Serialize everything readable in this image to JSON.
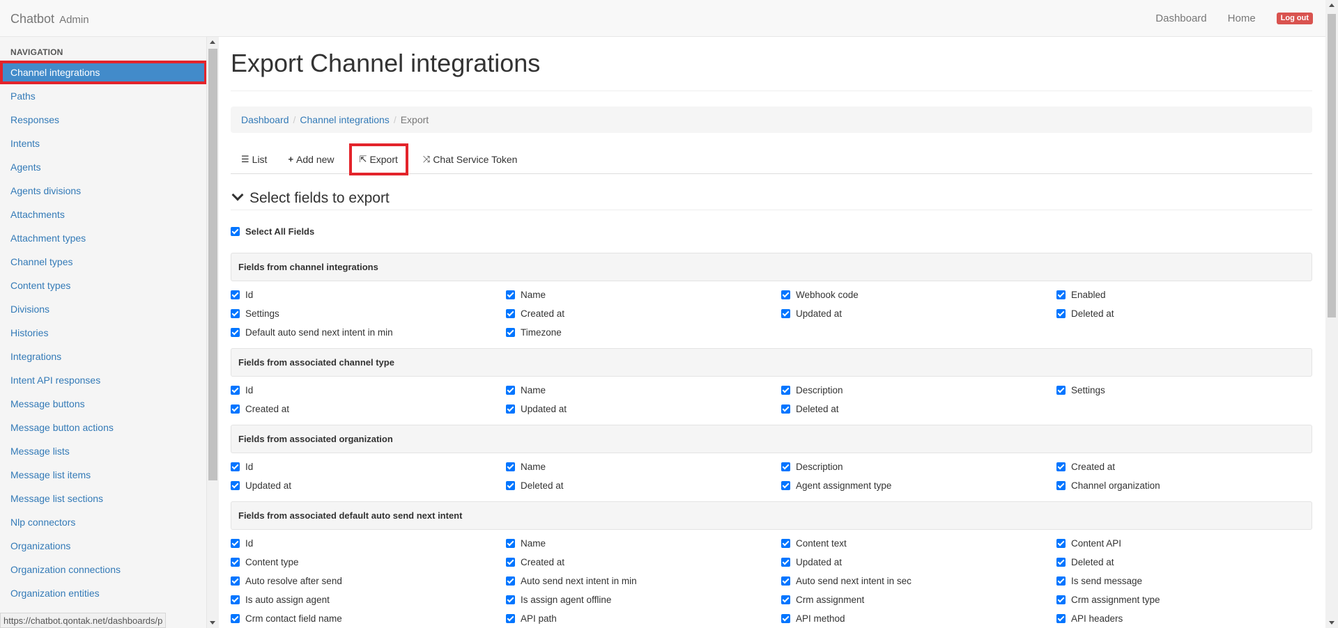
{
  "navbar": {
    "brand": "Chatbot",
    "brand_sub": "Admin",
    "links": [
      "Dashboard",
      "Home"
    ],
    "logout": "Log out"
  },
  "sidebar": {
    "heading": "NAVIGATION",
    "items": [
      "Channel integrations",
      "Paths",
      "Responses",
      "Intents",
      "Agents",
      "Agents divisions",
      "Attachments",
      "Attachment types",
      "Channel types",
      "Content types",
      "Divisions",
      "Histories",
      "Integrations",
      "Intent API responses",
      "Message buttons",
      "Message button actions",
      "Message lists",
      "Message list items",
      "Message list sections",
      "Nlp connectors",
      "Organizations",
      "Organization connections",
      "Organization entities"
    ],
    "active_index": 0
  },
  "status_bar": {
    "url": "https://chatbot.qontak.net/dashboards/p"
  },
  "page": {
    "title": "Export Channel integrations",
    "breadcrumb": {
      "items": [
        "Dashboard",
        "Channel integrations"
      ],
      "active": "Export"
    },
    "tabs": [
      {
        "icon": "☰",
        "icon_name": "list-icon",
        "label": "List"
      },
      {
        "icon": "+",
        "icon_name": "plus-icon",
        "label": "Add new"
      },
      {
        "icon": "⇱",
        "icon_name": "share-icon",
        "label": "Export"
      },
      {
        "icon": "⤨",
        "icon_name": "random-icon",
        "label": "Chat Service Token"
      }
    ],
    "section_title": "Select fields to export",
    "select_all": "Select All Fields"
  },
  "groups": [
    {
      "title": "Fields from channel integrations",
      "fields": [
        "Id",
        "Name",
        "Webhook code",
        "Enabled",
        "Settings",
        "Created at",
        "Updated at",
        "Deleted at",
        "Default auto send next intent in min",
        "Timezone"
      ]
    },
    {
      "title": "Fields from associated channel type",
      "fields": [
        "Id",
        "Name",
        "Description",
        "Settings",
        "Created at",
        "Updated at",
        "Deleted at"
      ]
    },
    {
      "title": "Fields from associated organization",
      "fields": [
        "Id",
        "Name",
        "Description",
        "Created at",
        "Updated at",
        "Deleted at",
        "Agent assignment type",
        "Channel organization"
      ]
    },
    {
      "title": "Fields from associated default auto send next intent",
      "fields": [
        "Id",
        "Name",
        "Content text",
        "Content API",
        "Content type",
        "Created at",
        "Updated at",
        "Deleted at",
        "Auto resolve after send",
        "Auto send next intent in min",
        "Auto send next intent in sec",
        "Is send message",
        "Is auto assign agent",
        "Is assign agent offline",
        "Crm assignment",
        "Crm assignment type",
        "Crm contact field name",
        "API path",
        "API method",
        "API headers"
      ]
    }
  ],
  "colors": {
    "link": "#337ab7",
    "active_nav": "#428bca",
    "highlight_box": "#e3242b",
    "logout": "#d9534f",
    "checkbox": "#0075ff"
  }
}
